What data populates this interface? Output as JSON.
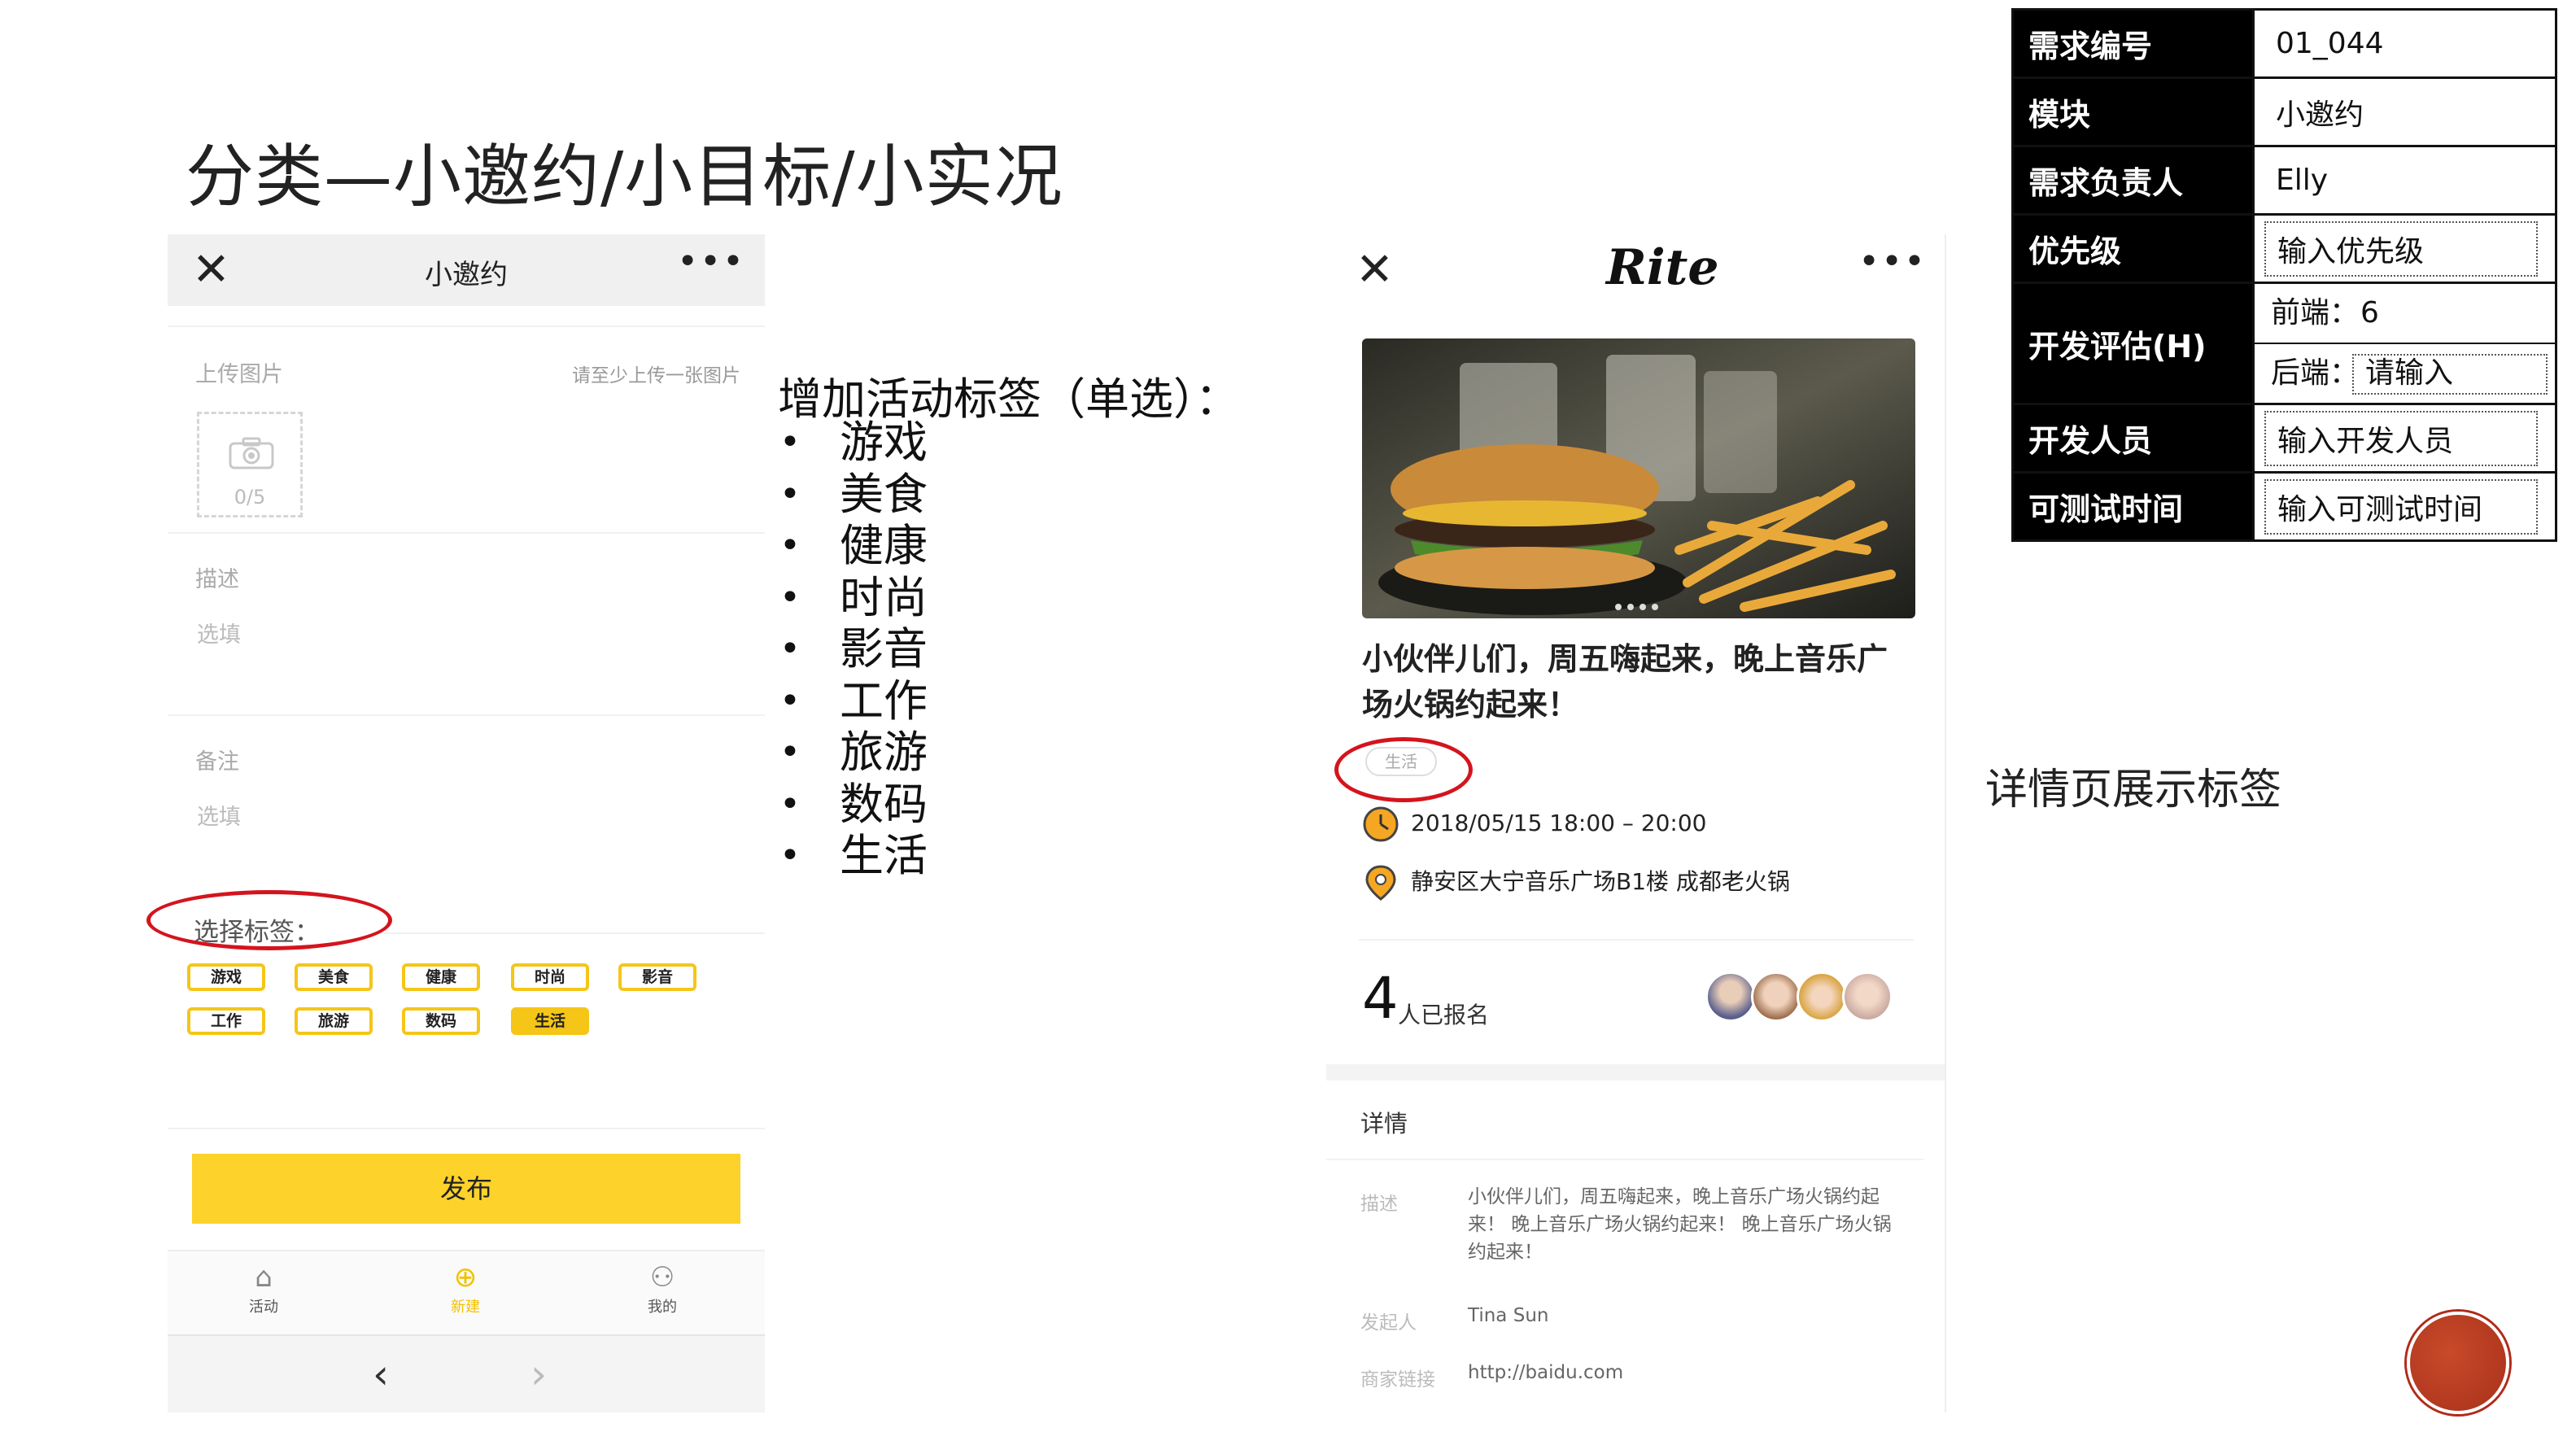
{
  "slide": {
    "title": "分类—小邀约/小目标/小实况"
  },
  "left_phone": {
    "nav": {
      "close": "✕",
      "title": "小邀约",
      "more": "•••"
    },
    "upload": {
      "label": "上传图片",
      "hint": "请至少上传一张图片",
      "count": "0/5"
    },
    "description": {
      "label": "描述",
      "placeholder": "选填"
    },
    "remark": {
      "label": "备注",
      "placeholder": "选填"
    },
    "tags": {
      "label": "选择标签：",
      "items": [
        "游戏",
        "美食",
        "健康",
        "时尚",
        "影音",
        "工作",
        "旅游",
        "数码",
        "生活"
      ],
      "selected": "生活"
    },
    "publish_label": "发布",
    "tabbar": [
      {
        "label": "活动",
        "icon": "home-icon",
        "glyph": "⌂"
      },
      {
        "label": "新建",
        "icon": "plus-circle-icon",
        "glyph": "⊕",
        "active": true
      },
      {
        "label": "我的",
        "icon": "user-icon",
        "glyph": "⚇"
      }
    ],
    "browser": {
      "back": "‹",
      "forward": "›"
    }
  },
  "middle_list": {
    "title": "增加活动标签（单选）：",
    "items": [
      "游戏",
      "美食",
      "健康",
      "时尚",
      "影音",
      "工作",
      "旅游",
      "数码",
      "生活"
    ]
  },
  "right_phone": {
    "nav": {
      "close": "✕",
      "logo": "Rite",
      "more": "•••"
    },
    "event_title": "小伙伴儿们，周五嗨起来，晚上音乐广场火锅约起来！",
    "tag": "生活",
    "time": "2018/05/15 18:00 – 20:00",
    "location": "静安区大宁音乐广场B1楼 成都老火锅",
    "signup": {
      "count": "4",
      "label": "人已报名"
    },
    "details": {
      "heading": "详情",
      "desc_label": "描述",
      "desc_value": "小伙伴儿们，周五嗨起来，晚上音乐广场火锅约起来！ 晚上音乐广场火锅约起来！ 晚上音乐广场火锅约起来！",
      "organizer_label": "发起人",
      "organizer_value": "Tina Sun",
      "link_label": "商家链接",
      "link_value": "http://baidu.com"
    }
  },
  "caption": "详情页展示标签",
  "info_table": {
    "rows": [
      {
        "key": "需求编号",
        "value": "01_044"
      },
      {
        "key": "模块",
        "value": "小邀约"
      },
      {
        "key": "需求负责人",
        "value": "Elly"
      },
      {
        "key": "优先级",
        "value": "输入优先级"
      },
      {
        "key": "开发评估(H)",
        "frontend_label": "前端：",
        "frontend_value": "6",
        "backend_label": "后端：",
        "backend_value": "请输入"
      },
      {
        "key": "开发人员",
        "value": "输入开发人员"
      },
      {
        "key": "可测试时间",
        "value": "输入可测试时间"
      }
    ]
  },
  "colors": {
    "accent_yellow": "#f5c518",
    "publish_yellow": "#fcd22b",
    "highlight_red": "#d4141d",
    "table_header": "#000000"
  }
}
